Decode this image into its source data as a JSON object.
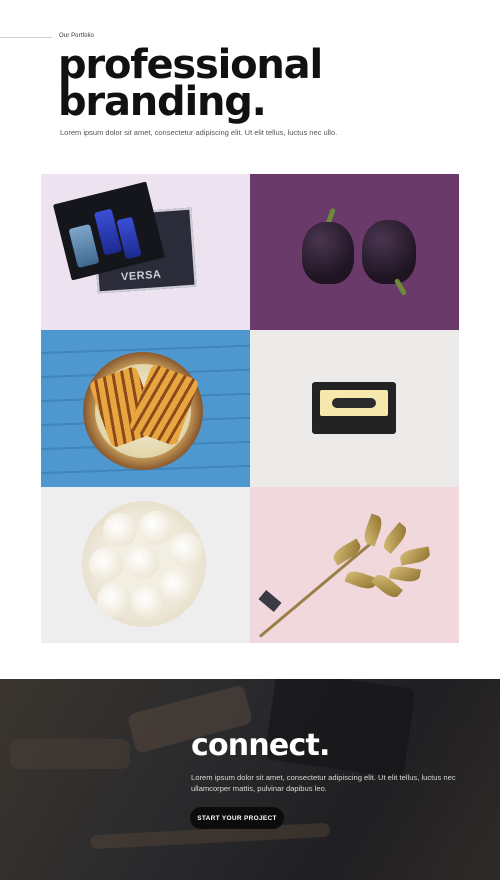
{
  "hero": {
    "eyebrow": "Our Portfolio",
    "title_line1": "professional",
    "title_line2": "branding.",
    "subtitle": "Lorem ipsum dolor sit amet, consectetur adipiscing elit.  Ut elit tellus, luctus nec ullo."
  },
  "portfolio": {
    "tiles": [
      {
        "subject": "perfume gift box on magazine",
        "text": "VERSA"
      },
      {
        "subject": "purple bell peppers"
      },
      {
        "subject": "grilled sandwich in wooden bowl"
      },
      {
        "subject": "cassette tape"
      },
      {
        "subject": "garlic bulb cross-section"
      },
      {
        "subject": "gold leaf branch"
      }
    ]
  },
  "connect": {
    "title": "connect.",
    "body": "Lorem ipsum dolor sit amet, consectetur adipiscing elit. Ut elit tellus, luctus nec ullamcorper mattis, pulvinar dapibus leo.",
    "cta_label": "START YOUR PROJECT"
  }
}
